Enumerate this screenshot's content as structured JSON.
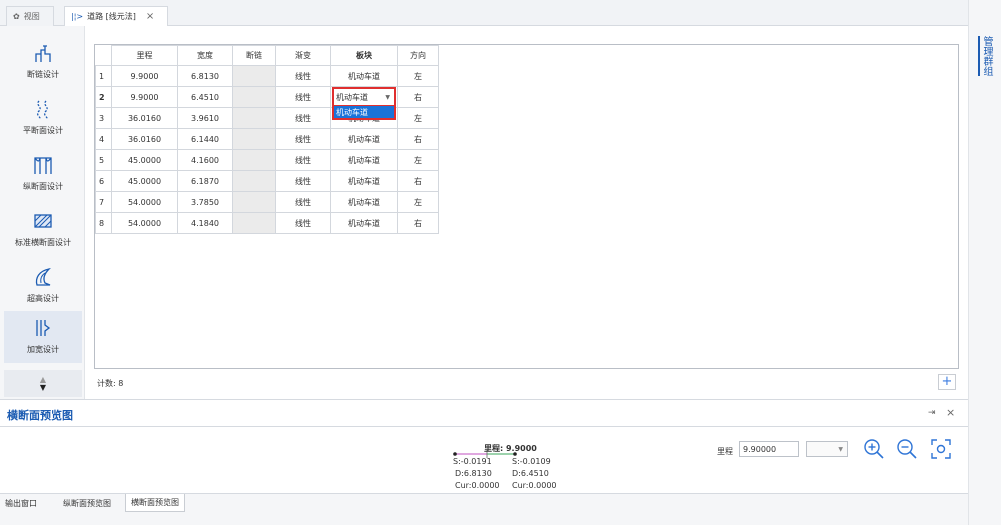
{
  "tabs": [
    {
      "label": "视图",
      "icon": "gear-icon"
    },
    {
      "label": "道路 [线元法]",
      "icon": "widening-icon",
      "close": "×"
    }
  ],
  "right_panel": {
    "label": "管理群组"
  },
  "sidebar": {
    "items": [
      {
        "label": "断链设计",
        "icon": "chain-break-icon"
      },
      {
        "label": "平断面设计",
        "icon": "plan-section-icon"
      },
      {
        "label": "纵断面设计",
        "icon": "profile-section-icon"
      },
      {
        "label": "标准横断面设计",
        "icon": "cross-section-icon"
      },
      {
        "label": "超高设计",
        "icon": "superelevation-icon"
      },
      {
        "label": "加宽设计",
        "icon": "widening-icon"
      }
    ],
    "scroll_up": "▲",
    "scroll_down": "▼"
  },
  "table": {
    "headers": [
      "里程",
      "宽度",
      "断链",
      "渐变",
      "板块",
      "方向"
    ],
    "rows": [
      {
        "idx": "1",
        "mileage": "9.9000",
        "width": "6.8130",
        "chain": "",
        "gradient": "线性",
        "block": "机动车道",
        "direction": "左"
      },
      {
        "idx": "2",
        "mileage": "9.9000",
        "width": "6.4510",
        "chain": "",
        "gradient": "线性",
        "block": "机动车道",
        "direction": "右"
      },
      {
        "idx": "3",
        "mileage": "36.0160",
        "width": "3.9610",
        "chain": "",
        "gradient": "线性",
        "block": "机动车道",
        "direction": "左"
      },
      {
        "idx": "4",
        "mileage": "36.0160",
        "width": "6.1440",
        "chain": "",
        "gradient": "线性",
        "block": "机动车道",
        "direction": "右"
      },
      {
        "idx": "5",
        "mileage": "45.0000",
        "width": "4.1600",
        "chain": "",
        "gradient": "线性",
        "block": "机动车道",
        "direction": "左"
      },
      {
        "idx": "6",
        "mileage": "45.0000",
        "width": "6.1870",
        "chain": "",
        "gradient": "线性",
        "block": "机动车道",
        "direction": "右"
      },
      {
        "idx": "7",
        "mileage": "54.0000",
        "width": "3.7850",
        "chain": "",
        "gradient": "线性",
        "block": "机动车道",
        "direction": "左"
      },
      {
        "idx": "8",
        "mileage": "54.0000",
        "width": "4.1840",
        "chain": "",
        "gradient": "线性",
        "block": "机动车道",
        "direction": "右"
      }
    ],
    "dropdown": {
      "value": "机动车道",
      "option": "机动车道"
    }
  },
  "count_label": "计数: 8",
  "add_button": "+",
  "preview": {
    "title": "横断面预览图",
    "pin": "⇥",
    "close": "×",
    "mileage_text": "里程: 9.9000",
    "left_s": "S:-0.0191",
    "right_s": "S:-0.0109",
    "left_d": "D:6.8130",
    "right_d": "D:6.4510",
    "left_cur": "Cur:0.0000",
    "right_cur": "Cur:0.0000",
    "mileage_label": "里程",
    "mileage_input": "9.90000"
  },
  "bottom_tabs": [
    "输出窗口",
    "纵断面预览图",
    "横断面预览图"
  ],
  "colors": {
    "accent": "#1b5bb2",
    "highlight": "#e02f2f",
    "selected": "#1a73d9"
  }
}
